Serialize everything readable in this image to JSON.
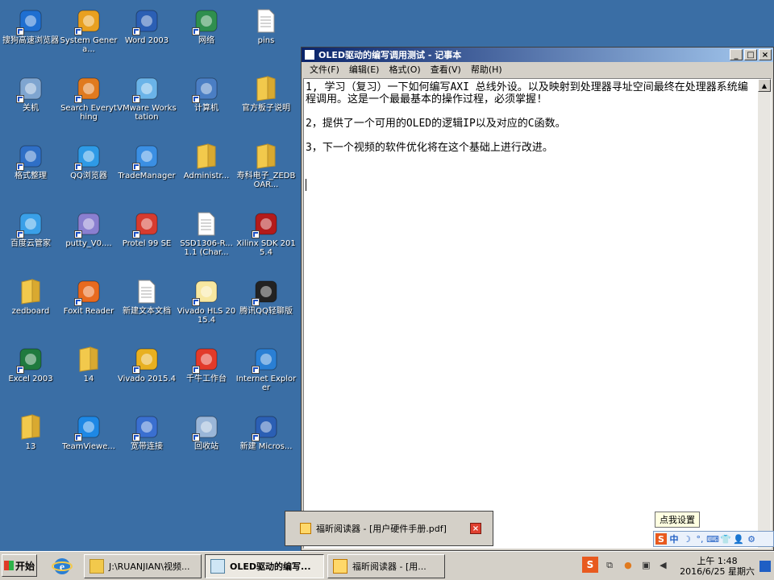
{
  "desktop": {
    "icons": [
      {
        "label": "搜狗高速浏览器",
        "icon": "sogou-browser-icon",
        "color": "#1f6fd1"
      },
      {
        "label": "System Genera...",
        "icon": "system-generator-icon",
        "color": "#e8a020"
      },
      {
        "label": "Word 2003",
        "icon": "word-icon",
        "color": "#2b5fb4"
      },
      {
        "label": "网络",
        "icon": "network-icon",
        "color": "#2f8f4e"
      },
      {
        "label": "pins",
        "icon": "text-file-icon",
        "color": "#ffffff"
      },
      {
        "label": "关机",
        "icon": "shutdown-icon",
        "color": "#7fa5d0"
      },
      {
        "label": "Search Everything",
        "icon": "search-everything-icon",
        "color": "#e07a1f"
      },
      {
        "label": "VMware Workstation",
        "icon": "vmware-icon",
        "color": "#6ab3e8"
      },
      {
        "label": "计算机",
        "icon": "computer-icon",
        "color": "#4a7ec4"
      },
      {
        "label": "官方板子说明",
        "icon": "folder-icon",
        "color": "#f2c94c"
      },
      {
        "label": "格式整理",
        "icon": "format-tool-icon",
        "color": "#2f6fc6"
      },
      {
        "label": "QQ浏览器",
        "icon": "qq-browser-icon",
        "color": "#2e9ae6"
      },
      {
        "label": "TradeManager",
        "icon": "trademanager-icon",
        "color": "#3b8fe3"
      },
      {
        "label": "Administr...",
        "icon": "user-folder-icon",
        "color": "#f2c94c"
      },
      {
        "label": "寿科电子_ZEDBOAR...",
        "icon": "folder-icon",
        "color": "#f2c94c"
      },
      {
        "label": "百度云管家",
        "icon": "baidu-cloud-icon",
        "color": "#3aa0e8"
      },
      {
        "label": "putty_V0....",
        "icon": "putty-icon",
        "color": "#8a7fd0"
      },
      {
        "label": "Protel 99 SE",
        "icon": "protel-icon",
        "color": "#d63b2f"
      },
      {
        "label": "SSD1306-R... 1.1 (Char...",
        "icon": "document-icon",
        "color": "#ffffff"
      },
      {
        "label": "Xilinx SDK 2015.4",
        "icon": "xilinx-sdk-icon",
        "color": "#b31b1b"
      },
      {
        "label": "zedboard",
        "icon": "folder-icon",
        "color": "#f2c94c"
      },
      {
        "label": "Foxit Reader",
        "icon": "foxit-reader-icon",
        "color": "#e86a1f"
      },
      {
        "label": "新建文本文档",
        "icon": "text-file-icon",
        "color": "#ffffff"
      },
      {
        "label": "Vivado HLS 2015.4",
        "icon": "vivado-hls-icon",
        "color": "#f7e7a0"
      },
      {
        "label": "腾讯QQ轻聊版",
        "icon": "qq-icon",
        "color": "#222222"
      },
      {
        "label": "Excel 2003",
        "icon": "excel-icon",
        "color": "#1f7a3e"
      },
      {
        "label": "14",
        "icon": "folder-icon",
        "color": "#f2c94c"
      },
      {
        "label": "Vivado 2015.4",
        "icon": "vivado-icon",
        "color": "#e8b020"
      },
      {
        "label": "千牛工作台",
        "icon": "qianniu-icon",
        "color": "#e23a2a"
      },
      {
        "label": "Internet Explorer",
        "icon": "ie-icon",
        "color": "#2a7fd4"
      },
      {
        "label": "13",
        "icon": "folder-icon",
        "color": "#f2c94c"
      },
      {
        "label": "TeamViewe...",
        "icon": "teamviewer-icon",
        "color": "#1e88e5"
      },
      {
        "label": "宽带连接",
        "icon": "broadband-icon",
        "color": "#3a6fd0"
      },
      {
        "label": "回收站",
        "icon": "recycle-bin-icon",
        "color": "#9ab6d8"
      },
      {
        "label": "新建 Micros...",
        "icon": "word-doc-icon",
        "color": "#2b5fb4"
      }
    ]
  },
  "notepad": {
    "title": "OLED驱动的编写调用测试 - 记事本",
    "menu": [
      "文件(F)",
      "编辑(E)",
      "格式(O)",
      "查看(V)",
      "帮助(H)"
    ],
    "lines": [
      "1, 学习（复习）一下如何编写AXI 总线外设。以及映射到处理器寻址空间最终在处理器系统编程调用。这是一个最最基本的操作过程，必须掌握!",
      "2，提供了一个可用的OLED的逻辑IP以及对应的C函数。",
      "3，下一个视频的软件优化将在这个基础上进行改进。"
    ]
  },
  "popup": {
    "text": "福昕阅读器 - [用户硬件手册.pdf]"
  },
  "ime": {
    "tip": "点我设置",
    "items": [
      "S",
      "中",
      "☽",
      "°,",
      "⌨",
      "👕",
      "👤",
      "⚙"
    ]
  },
  "taskbar": {
    "start": "开始",
    "items": [
      {
        "label": "J:\\RUANJIAN\\视频...",
        "icon": "folder-icon"
      },
      {
        "label": "OLED驱动的编写...",
        "icon": "notepad-icon"
      },
      {
        "label": "福昕阅读器 - [用...",
        "icon": "foxit-reader-icon"
      }
    ],
    "clock_time": "上午 1:48",
    "clock_date": "2016/6/25 星期六"
  }
}
